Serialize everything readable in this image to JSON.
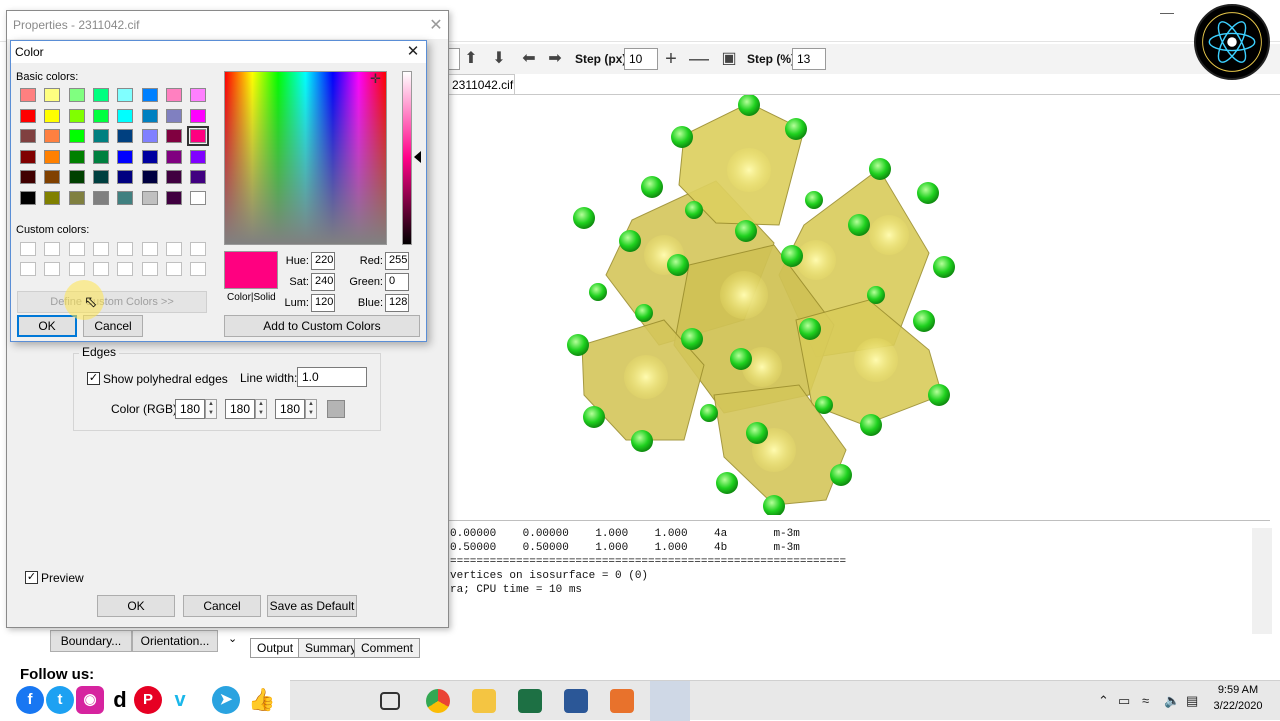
{
  "app": {
    "toolbar": {
      "step_px_label": "Step (px):",
      "step_px_value": "10",
      "step_pct_label": "Step (%):",
      "step_pct_value": "13"
    },
    "view_tab": "2311042.cif",
    "output_lines": [
      "0.00000    0.00000    1.000    1.000    4a       m-3m",
      "0.50000    0.50000    1.000    1.000    4b       m-3m",
      "============================================================",
      "",
      "vertices on isosurface = 0 (0)",
      "ra; CPU time = 10 ms"
    ],
    "bottom_tabs": [
      "Output",
      "Summary",
      "Comment"
    ],
    "panel_buttons": [
      "Boundary...",
      "Orientation..."
    ]
  },
  "properties": {
    "title": "Properties - 2311042.cif",
    "edges": {
      "group_label": "Edges",
      "show_label": "Show polyhedral edges",
      "show_checked": true,
      "line_width_label": "Line width:",
      "line_width_value": "1.0",
      "color_label": "Color (RGB):",
      "r": "180",
      "g": "180",
      "b": "180"
    },
    "preview_label": "Preview",
    "preview_checked": true,
    "ok_label": "OK",
    "cancel_label": "Cancel",
    "save_default_label": "Save as Default"
  },
  "color_dialog": {
    "title": "Color",
    "basic_colors_label": "Basic colors:",
    "custom_colors_label": "Custom colors:",
    "define_custom_label": "Define Custom Colors >>",
    "ok_label": "OK",
    "cancel_label": "Cancel",
    "add_custom_label": "Add to Custom Colors",
    "color_solid_label": "Color|Solid",
    "hue_label": "Hue:",
    "hue": "220",
    "sat_label": "Sat:",
    "sat": "240",
    "lum_label": "Lum:",
    "lum": "120",
    "red_label": "Red:",
    "red": "255",
    "green_label": "Green:",
    "green": "0",
    "blue_label": "Blue:",
    "blue": "128",
    "basic_colors": [
      [
        "#ff8080",
        "#ffff80",
        "#80ff80",
        "#00ff80",
        "#80ffff",
        "#0080ff",
        "#ff80c0",
        "#ff80ff"
      ],
      [
        "#ff0000",
        "#ffff00",
        "#80ff00",
        "#00ff40",
        "#00ffff",
        "#0080c0",
        "#8080c0",
        "#ff00ff"
      ],
      [
        "#804040",
        "#ff8040",
        "#00ff00",
        "#008080",
        "#004080",
        "#8080ff",
        "#800040",
        "#ff0080"
      ],
      [
        "#800000",
        "#ff8000",
        "#008000",
        "#008040",
        "#0000ff",
        "#0000a0",
        "#800080",
        "#8000ff"
      ],
      [
        "#400000",
        "#804000",
        "#004000",
        "#004040",
        "#000080",
        "#000040",
        "#400040",
        "#400080"
      ],
      [
        "#000000",
        "#808000",
        "#808040",
        "#808080",
        "#408080",
        "#c0c0c0",
        "#400040",
        "#ffffff"
      ]
    ],
    "selected_swatch": "#ff0080"
  },
  "follow": {
    "label": "Follow us:",
    "icons": [
      "facebook-icon",
      "twitter-icon",
      "instagram-icon",
      "dailymotion-icon",
      "pinterest-icon",
      "vimeo-icon",
      "telegram-icon",
      "like-icon"
    ]
  },
  "taskbar": {
    "time": "9:59 AM",
    "date": "3/22/2020"
  },
  "colors": {
    "polyhedra": "#d9cc5a",
    "atoms": "#22cc22",
    "accent": "#0078d7",
    "selected_color": "#ff0080"
  }
}
